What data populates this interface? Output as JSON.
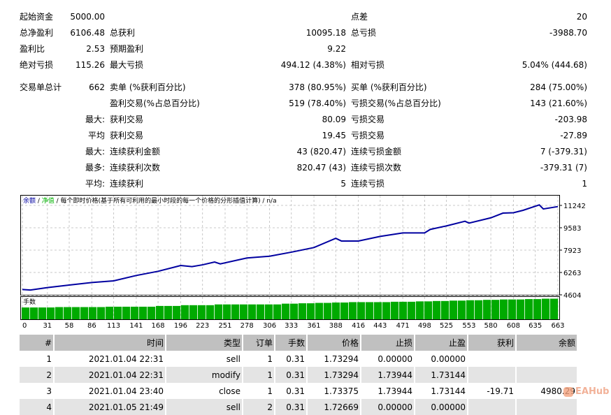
{
  "stats": {
    "rows": [
      {
        "l1": "起始资金",
        "v1": "5000.00",
        "l2": "",
        "v2": "",
        "l3": "点差",
        "v3": "20"
      },
      {
        "l1": "总净盈利",
        "v1": "6106.48",
        "l2": "总获利",
        "v2": "10095.18",
        "l3": "总亏损",
        "v3": "-3988.70"
      },
      {
        "l1": "盈利比",
        "v1": "2.53",
        "l2": "预期盈利",
        "v2": "9.22",
        "l3": "",
        "v3": ""
      },
      {
        "l1": "绝对亏损",
        "v1": "115.26",
        "l2": "最大亏损",
        "v2": "494.12 (4.38%)",
        "l3": "相对亏损",
        "v3": "5.04% (444.68)"
      },
      {
        "l1": "交易单总计",
        "v1": "662",
        "l2": "卖单 (%获利百分比)",
        "v2": "378 (80.95%)",
        "l3": "买单 (%获利百分比)",
        "v3": "284 (75.00%)"
      },
      {
        "l1": "",
        "v1": "",
        "l2": "盈利交易(%占总百分比)",
        "v2": "519 (78.40%)",
        "l3": "亏损交易(%占总百分比)",
        "v3": "143 (21.60%)"
      },
      {
        "l1": "",
        "v1": "最大:",
        "l2": "获利交易",
        "v2": "80.09",
        "l3": "亏损交易",
        "v3": "-203.98"
      },
      {
        "l1": "",
        "v1": "平均",
        "l2": "获利交易",
        "v2": "19.45",
        "l3": "亏损交易",
        "v3": "-27.89"
      },
      {
        "l1": "",
        "v1": "最大:",
        "l2": "连续获利金额",
        "v2": "43 (820.47)",
        "l3": "连续亏损金额",
        "v3": "7 (-379.31)"
      },
      {
        "l1": "",
        "v1": "最多:",
        "l2": "连续获利次数",
        "v2": "820.47 (43)",
        "l3": "连续亏损次数",
        "v3": "-379.31 (7)"
      },
      {
        "l1": "",
        "v1": "平均:",
        "l2": "连续获利",
        "v2": "5",
        "l3": "连续亏损",
        "v3": "1"
      }
    ]
  },
  "chart_data": {
    "type": "line",
    "legend": {
      "balance": "余额",
      "sep1": " / ",
      "equity": "净值",
      "rest": " / 每个即时价格(基于所有可利用的最小时段的每一个价格的分形插值计算) / n/a"
    },
    "volume_label": "手数",
    "colors": {
      "balance": "#0000a0",
      "equity": "#00b000",
      "volume": "#00aa00",
      "grid": "#c8c8c8"
    },
    "y_ticks": [
      11242,
      9583,
      7923,
      6263,
      4604
    ],
    "ylim": [
      4604,
      11242
    ],
    "x_ticks": [
      0,
      31,
      58,
      86,
      113,
      141,
      168,
      196,
      223,
      251,
      278,
      306,
      333,
      361,
      388,
      416,
      443,
      471,
      498,
      525,
      553,
      580,
      608,
      635,
      663
    ],
    "xlim": [
      0,
      663
    ],
    "grid": true,
    "balance": [
      [
        0,
        5000
      ],
      [
        10,
        4960
      ],
      [
        31,
        5140
      ],
      [
        58,
        5330
      ],
      [
        86,
        5520
      ],
      [
        113,
        5640
      ],
      [
        141,
        6040
      ],
      [
        168,
        6350
      ],
      [
        196,
        6780
      ],
      [
        210,
        6700
      ],
      [
        223,
        6830
      ],
      [
        238,
        7040
      ],
      [
        245,
        6900
      ],
      [
        278,
        7340
      ],
      [
        306,
        7470
      ],
      [
        333,
        7770
      ],
      [
        361,
        8115
      ],
      [
        388,
        8800
      ],
      [
        395,
        8600
      ],
      [
        416,
        8600
      ],
      [
        443,
        8940
      ],
      [
        471,
        9200
      ],
      [
        498,
        9200
      ],
      [
        505,
        9460
      ],
      [
        525,
        9720
      ],
      [
        548,
        10065
      ],
      [
        553,
        9930
      ],
      [
        580,
        10320
      ],
      [
        595,
        10670
      ],
      [
        608,
        10700
      ],
      [
        620,
        10880
      ],
      [
        640,
        11280
      ],
      [
        645,
        10980
      ],
      [
        663,
        11155
      ]
    ],
    "volume": [
      0.31,
      0.31,
      0.31,
      0.31,
      0.32,
      0.32,
      0.32,
      0.32,
      0.32,
      0.32,
      0.33,
      0.33,
      0.33,
      0.33,
      0.33,
      0.33,
      0.35,
      0.35,
      0.35,
      0.37,
      0.37,
      0.37,
      0.37,
      0.39,
      0.39,
      0.39,
      0.39,
      0.39,
      0.39,
      0.39,
      0.39,
      0.41,
      0.41,
      0.42,
      0.42,
      0.43,
      0.43,
      0.44,
      0.44,
      0.45,
      0.45,
      0.45,
      0.45,
      0.45,
      0.46,
      0.46,
      0.46,
      0.47,
      0.47,
      0.48,
      0.48,
      0.49,
      0.49,
      0.5,
      0.5,
      0.51,
      0.51,
      0.52,
      0.52,
      0.52,
      0.53,
      0.53,
      0.54,
      0.54
    ]
  },
  "table": {
    "headers": [
      "#",
      "时间",
      "类型",
      "订单",
      "手数",
      "价格",
      "止损",
      "止盈",
      "获利",
      "余额"
    ],
    "rows": [
      [
        "1",
        "2021.01.04 22:31",
        "sell",
        "1",
        "0.31",
        "1.73294",
        "0.00000",
        "0.00000",
        "",
        ""
      ],
      [
        "2",
        "2021.01.04 22:31",
        "modify",
        "1",
        "0.31",
        "1.73294",
        "1.73944",
        "1.73144",
        "",
        ""
      ],
      [
        "3",
        "2021.01.04 23:40",
        "close",
        "1",
        "0.31",
        "1.73375",
        "1.73944",
        "1.73144",
        "-19.71",
        "4980.29"
      ],
      [
        "4",
        "2021.01.05 21:49",
        "sell",
        "2",
        "0.31",
        "1.72669",
        "0.00000",
        "0.00000",
        "",
        ""
      ]
    ]
  },
  "watermark": "EAHub"
}
